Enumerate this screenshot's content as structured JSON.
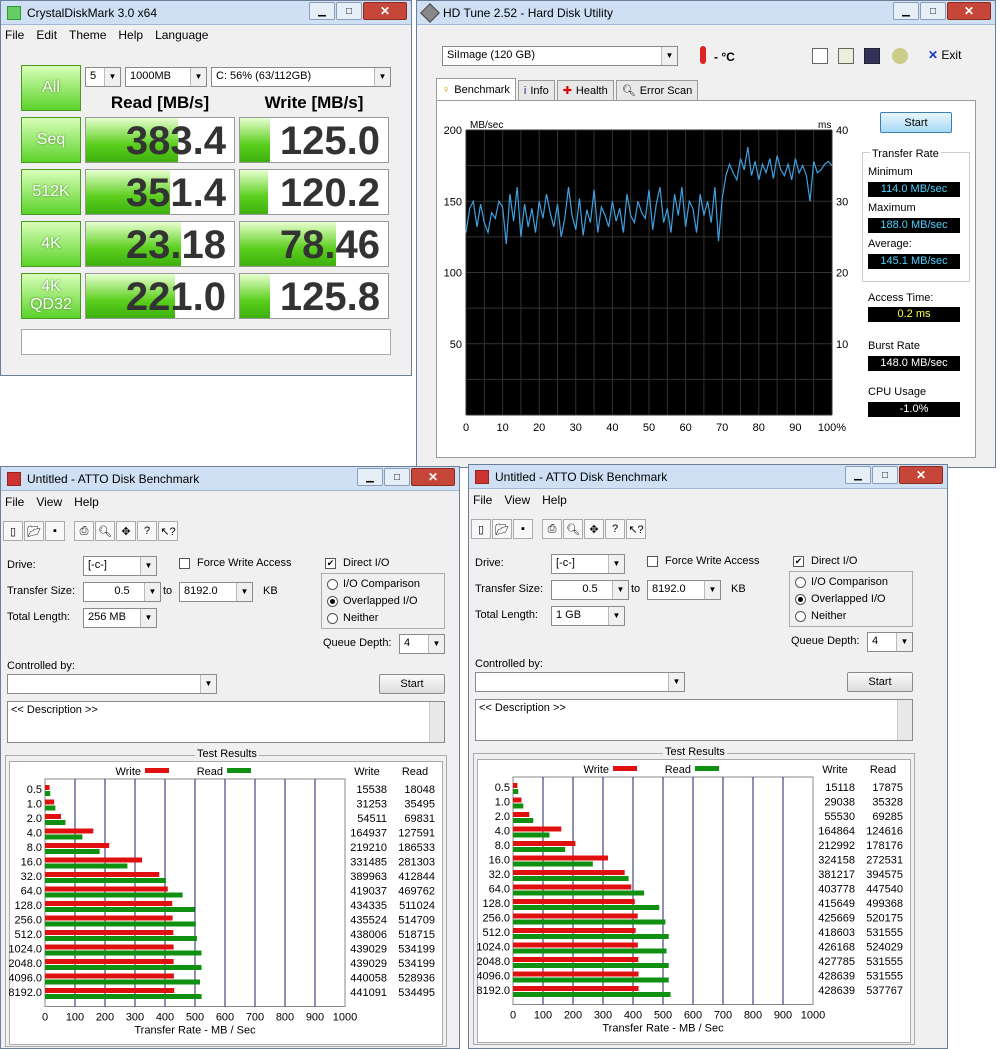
{
  "cdm": {
    "title": "CrystalDiskMark 3.0 x64",
    "menu": [
      "File",
      "Edit",
      "Theme",
      "Help",
      "Language"
    ],
    "all_label": "All",
    "count": "5",
    "size": "1000MB",
    "drive": "C: 56% (63/112GB)",
    "read_header": "Read [MB/s]",
    "write_header": "Write [MB/s]",
    "rows": [
      {
        "label": "Seq",
        "read": "383.4",
        "write": "125.0",
        "read_frac": 0.62,
        "write_frac": 0.2
      },
      {
        "label": "512K",
        "read": "351.4",
        "write": "120.2",
        "read_frac": 0.57,
        "write_frac": 0.19
      },
      {
        "label": "4K",
        "read": "23.18",
        "write": "78.46",
        "read_frac": 0.64,
        "write_frac": 0.65
      },
      {
        "label": "4K\nQD32",
        "read": "221.0",
        "write": "125.8",
        "read_frac": 0.6,
        "write_frac": 0.2
      }
    ]
  },
  "hdt": {
    "title": "HD Tune 2.52 - Hard Disk Utility",
    "drive": "SiImage  (120 GB)",
    "temp": "- °C",
    "exit": "Exit",
    "tabs": [
      "Benchmark",
      "Info",
      "Health",
      "Error Scan"
    ],
    "start": "Start",
    "transfer_rate": "Transfer Rate",
    "minimum_label": "Minimum",
    "minimum": "114.0 MB/sec",
    "maximum_label": "Maximum",
    "maximum": "188.0 MB/sec",
    "average_label": "Average:",
    "average": "145.1 MB/sec",
    "access_label": "Access Time:",
    "access": "0.2 ms",
    "burst_label": "Burst Rate",
    "burst": "148.0 MB/sec",
    "cpu_label": "CPU Usage",
    "cpu": "-1.0%",
    "chart_data": {
      "type": "line",
      "ylabel": "MB/sec",
      "y2label": "ms",
      "yticks": [
        "200",
        "150",
        "100",
        "50"
      ],
      "y2ticks": [
        "40",
        "30",
        "20",
        "10"
      ],
      "xticks": [
        "0",
        "10",
        "20",
        "30",
        "40",
        "50",
        "60",
        "70",
        "80",
        "90",
        "100%"
      ],
      "ylim": [
        0,
        200
      ],
      "xlim": [
        0,
        100
      ],
      "series": [
        {
          "values": [
            128,
            145,
            150,
            132,
            148,
            135,
            128,
            142,
            138,
            150,
            146,
            120,
            155,
            136,
            160,
            125,
            148,
            132,
            145,
            128,
            150,
            138,
            155,
            142,
            132,
            148,
            125,
            138,
            160,
            140,
            130,
            152,
            126,
            144,
            135,
            158,
            128,
            146,
            140,
            132,
            150,
            136,
            145,
            128,
            155,
            140,
            135,
            150,
            142,
            138,
            158,
            130,
            148,
            160,
            135,
            145,
            128,
            155,
            140,
            160,
            132,
            150,
            145,
            128,
            155,
            140,
            150,
            135,
            160,
            122,
            152,
            168,
            176,
            170,
            165,
            180,
            172,
            188,
            168,
            178,
            165,
            176,
            170,
            180,
            166,
            182,
            172,
            168,
            176,
            165,
            180,
            170,
            175,
            168,
            150,
            178,
            170,
            172,
            176,
            178,
            175
          ]
        }
      ]
    }
  },
  "atto_left": {
    "title": "Untitled - ATTO Disk Benchmark",
    "menu": [
      "File",
      "View",
      "Help"
    ],
    "drive_label": "Drive:",
    "drive": "[-c-]",
    "force_write": "Force Write Access",
    "direct_io": "Direct I/O",
    "transfer_label": "Transfer Size:",
    "ts_from": "0.5",
    "to": "to",
    "ts_to": "8192.0",
    "kb": "KB",
    "length_label": "Total Length:",
    "length": "256 MB",
    "io_comparison": "I/O Comparison",
    "overlapped": "Overlapped I/O",
    "neither": "Neither",
    "queue_label": "Queue Depth:",
    "queue": "4",
    "controlled_label": "Controlled by:",
    "start": "Start",
    "description": "<< Description >>",
    "results_title": "Test Results",
    "write_legend": "Write",
    "read_legend": "Read",
    "col_write": "Write",
    "col_read": "Read",
    "xlabel": "Transfer Rate - MB / Sec",
    "chart_data": {
      "type": "bar",
      "categories": [
        "0.5",
        "1.0",
        "2.0",
        "4.0",
        "8.0",
        "16.0",
        "32.0",
        "64.0",
        "128.0",
        "256.0",
        "512.0",
        "1024.0",
        "2048.0",
        "4096.0",
        "8192.0"
      ],
      "series": [
        {
          "name": "Write",
          "values": [
            15538,
            31253,
            54511,
            164937,
            219210,
            331485,
            389963,
            419037,
            434335,
            435524,
            438006,
            439029,
            439029,
            440058,
            441091
          ]
        },
        {
          "name": "Read",
          "values": [
            18048,
            35495,
            69831,
            127591,
            186533,
            281303,
            412844,
            469762,
            511024,
            514709,
            518715,
            534199,
            534199,
            528936,
            534495
          ]
        }
      ],
      "xticks": [
        "0",
        "100",
        "200",
        "300",
        "400",
        "500",
        "600",
        "700",
        "800",
        "900",
        "1000"
      ],
      "xlim": [
        0,
        1000
      ]
    }
  },
  "atto_right": {
    "title": "Untitled - ATTO Disk Benchmark",
    "menu": [
      "File",
      "View",
      "Help"
    ],
    "drive_label": "Drive:",
    "drive": "[-c-]",
    "force_write": "Force Write Access",
    "direct_io": "Direct I/O",
    "transfer_label": "Transfer Size:",
    "ts_from": "0.5",
    "to": "to",
    "ts_to": "8192.0",
    "kb": "KB",
    "length_label": "Total Length:",
    "length": "1 GB",
    "io_comparison": "I/O Comparison",
    "overlapped": "Overlapped I/O",
    "neither": "Neither",
    "queue_label": "Queue Depth:",
    "queue": "4",
    "controlled_label": "Controlled by:",
    "start": "Start",
    "description": "<< Description >>",
    "results_title": "Test Results",
    "write_legend": "Write",
    "read_legend": "Read",
    "col_write": "Write",
    "col_read": "Read",
    "xlabel": "Transfer Rate - MB / Sec",
    "chart_data": {
      "type": "bar",
      "categories": [
        "0.5",
        "1.0",
        "2.0",
        "4.0",
        "8.0",
        "16.0",
        "32.0",
        "64.0",
        "128.0",
        "256.0",
        "512.0",
        "1024.0",
        "2048.0",
        "4096.0",
        "8192.0"
      ],
      "series": [
        {
          "name": "Write",
          "values": [
            15118,
            29038,
            55530,
            164864,
            212992,
            324158,
            381217,
            403778,
            415649,
            425669,
            418603,
            426168,
            427785,
            428639,
            428639
          ]
        },
        {
          "name": "Read",
          "values": [
            17875,
            35328,
            69285,
            124616,
            178176,
            272531,
            394575,
            447540,
            499368,
            520175,
            531555,
            524029,
            531555,
            531555,
            537767
          ]
        }
      ],
      "xticks": [
        "0",
        "100",
        "200",
        "300",
        "400",
        "500",
        "600",
        "700",
        "800",
        "900",
        "1000"
      ],
      "xlim": [
        0,
        1000
      ]
    }
  },
  "colors": {
    "write": "#e01010",
    "read": "#109010",
    "hdt_line": "#3fa0e0",
    "hdt_value": "#4fd0ff",
    "hdt_access": "#ffff40"
  }
}
